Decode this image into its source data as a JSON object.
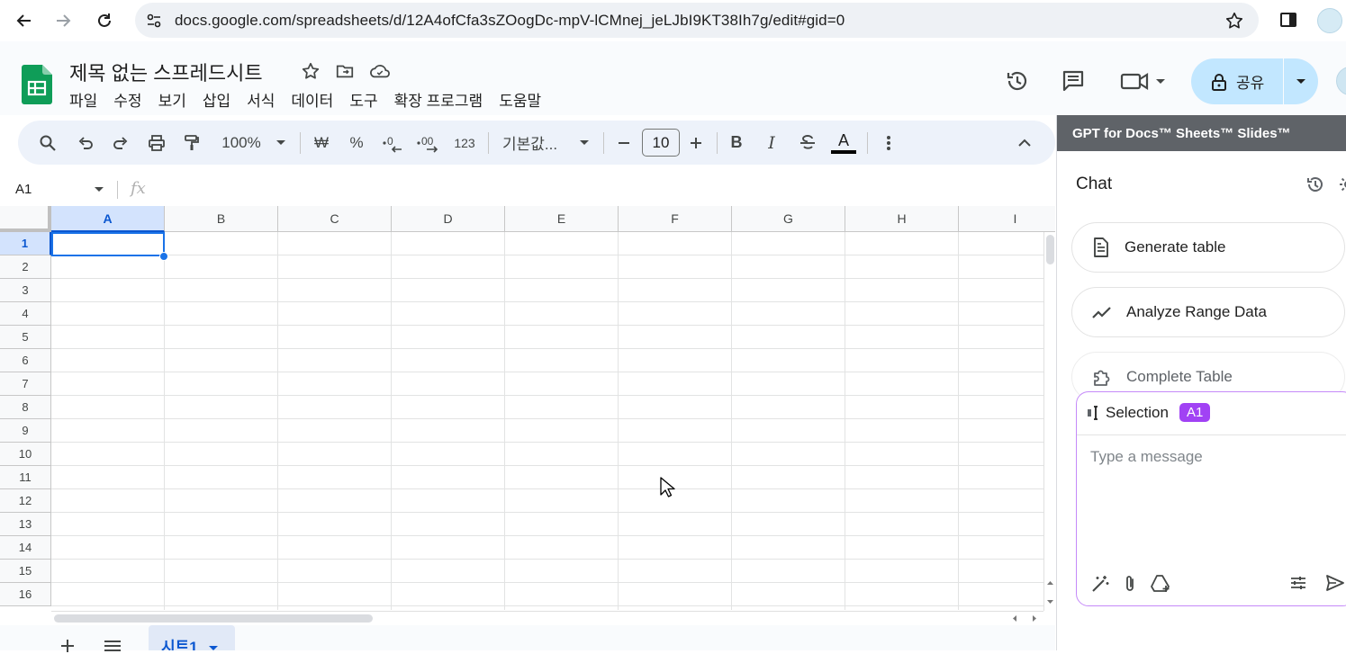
{
  "browser": {
    "url": "docs.google.com/spreadsheets/d/12A4ofCfa3sZOogDc-mpV-lCMnej_jeLJbI9KT38Ih7g/edit#gid=0"
  },
  "doc": {
    "title": "제목 없는 스프레드시트"
  },
  "menu": [
    "파일",
    "수정",
    "보기",
    "삽입",
    "서식",
    "데이터",
    "도구",
    "확장 프로그램",
    "도움말"
  ],
  "share": {
    "label": "공유"
  },
  "toolbar": {
    "zoom": "100%",
    "currency": "₩",
    "percent": "%",
    "number_format": "123",
    "font": "기본값...",
    "font_size": "10",
    "bold": "B",
    "italic": "I",
    "text_color": "A"
  },
  "formula_bar": {
    "namebox": "A1",
    "fx": "fx"
  },
  "grid": {
    "columns": [
      "A",
      "B",
      "C",
      "D",
      "E",
      "F",
      "G",
      "H",
      "I"
    ],
    "rows": [
      "1",
      "2",
      "3",
      "4",
      "5",
      "6",
      "7",
      "8",
      "9",
      "10",
      "11",
      "12",
      "13",
      "14",
      "15",
      "16"
    ],
    "active_cell": "A1"
  },
  "sheet_tabs": {
    "active": "시트1"
  },
  "panel": {
    "header": "GPT for Docs™ Sheets™ Slides™",
    "chat_title": "Chat",
    "actions": [
      "Generate table",
      "Analyze Range Data",
      "Complete Table"
    ],
    "selection_label": "Selection",
    "selection_value": "A1",
    "message_placeholder": "Type a message"
  },
  "colors": {
    "accent": "#0b57d0",
    "share_bg": "#c2e7ff",
    "panel_header": "#5f6368",
    "selection_badge": "#a142f4"
  }
}
